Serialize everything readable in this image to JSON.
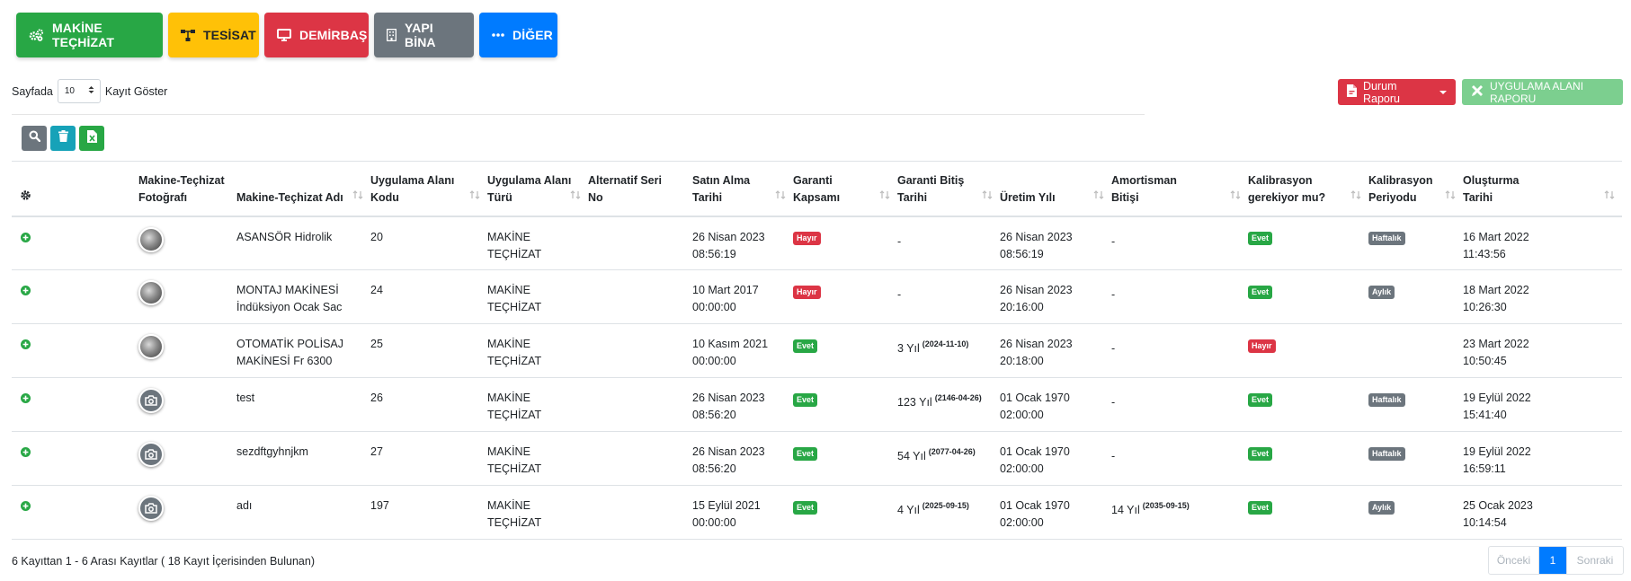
{
  "categories": [
    {
      "label": "MAKİNE TEÇHİZAT",
      "icon": "gears-icon",
      "color": "#28a745"
    },
    {
      "label": "TESİSAT",
      "icon": "network-icon",
      "color": "#ffc107"
    },
    {
      "label": "DEMİRBAŞ",
      "icon": "monitor-icon",
      "color": "#dc3545"
    },
    {
      "label": "YAPI BİNA",
      "icon": "building-icon",
      "color": "#6c757d"
    },
    {
      "label": "DİĞER",
      "icon": "ellipsis-icon",
      "color": "#007bff"
    }
  ],
  "length": {
    "prefix": "Sayfada",
    "value": "10",
    "suffix": "Kayıt Göster"
  },
  "reports": {
    "status_report": "Durum Raporu",
    "application_area_report": "UYGULAMA ALANI RAPORU"
  },
  "table": {
    "headers": {
      "photo": [
        "Makine-Teçhizat",
        "Fotoğrafı"
      ],
      "name": "Makine-Teçhizat Adı",
      "code": [
        "Uygulama Alanı",
        "Kodu"
      ],
      "type": [
        "Uygulama Alanı",
        "Türü"
      ],
      "serial": [
        "Alternatif Seri",
        "No"
      ],
      "purchase": [
        "Satın Alma",
        "Tarihi"
      ],
      "warranty": [
        "Garanti",
        "Kapsamı"
      ],
      "warranty_end": [
        "Garanti Bitiş",
        "Tarihi"
      ],
      "production": "Üretim Yılı",
      "amortization": [
        "Amortisman",
        "Bitişi"
      ],
      "calibration": [
        "Kalibrasyon",
        "gerekiyor mu?"
      ],
      "calibration_period": [
        "Kalibrasyon",
        "Periyodu"
      ],
      "created": [
        "Oluşturma",
        "Tarihi"
      ]
    },
    "rows": [
      {
        "photo": "image",
        "name": [
          "ASANSÖR Hidrolik",
          ""
        ],
        "code": "20",
        "type": "MAKİNE TEÇHİZAT",
        "serial": "",
        "purchase": [
          "26 Nisan 2023",
          "08:56:19"
        ],
        "warranty": "Hayır",
        "warranty_color": "#dc3545",
        "warranty_end": "-",
        "warranty_end_date": "",
        "production": [
          "26 Nisan 2023",
          "08:56:19"
        ],
        "amortization": "-",
        "amortization_date": "",
        "calibration": "Evet",
        "calibration_color": "#28a745",
        "period": "Haftalık",
        "created": [
          "16 Mart 2022",
          "11:43:56"
        ]
      },
      {
        "photo": "image",
        "name": [
          "MONTAJ MAKİNESİ",
          "İndüksiyon Ocak Sac"
        ],
        "code": "24",
        "type": "MAKİNE TEÇHİZAT",
        "serial": "",
        "purchase": [
          "10 Mart 2017",
          "00:00:00"
        ],
        "warranty": "Hayır",
        "warranty_color": "#dc3545",
        "warranty_end": "-",
        "warranty_end_date": "",
        "production": [
          "26 Nisan 2023",
          "20:16:00"
        ],
        "amortization": "-",
        "amortization_date": "",
        "calibration": "Evet",
        "calibration_color": "#28a745",
        "period": "Aylık",
        "created": [
          "18 Mart 2022",
          "10:26:30"
        ]
      },
      {
        "photo": "image",
        "name": [
          "OTOMATİK POLİSAJ",
          "MAKİNESİ Fr 6300"
        ],
        "code": "25",
        "type": "MAKİNE TEÇHİZAT",
        "serial": "",
        "purchase": [
          "10 Kasım 2021",
          "00:00:00"
        ],
        "warranty": "Evet",
        "warranty_color": "#28a745",
        "warranty_end": "3 Yıl",
        "warranty_end_date": "(2024-11-10)",
        "production": [
          "26 Nisan 2023",
          "20:18:00"
        ],
        "amortization": "-",
        "amortization_date": "",
        "calibration": "Hayır",
        "calibration_color": "#dc3545",
        "period": "",
        "created": [
          "23 Mart 2022",
          "10:50:45"
        ]
      },
      {
        "photo": "camera",
        "name": [
          "test",
          ""
        ],
        "code": "26",
        "type": "MAKİNE TEÇHİZAT",
        "serial": "",
        "purchase": [
          "26 Nisan 2023",
          "08:56:20"
        ],
        "warranty": "Evet",
        "warranty_color": "#28a745",
        "warranty_end": "123 Yıl",
        "warranty_end_date": "(2146-04-26)",
        "production": [
          "01 Ocak 1970",
          "02:00:00"
        ],
        "amortization": "-",
        "amortization_date": "",
        "calibration": "Evet",
        "calibration_color": "#28a745",
        "period": "Haftalık",
        "created": [
          "19 Eylül 2022",
          "15:41:40"
        ]
      },
      {
        "photo": "camera",
        "name": [
          "sezdftgyhnjkm",
          ""
        ],
        "code": "27",
        "type": "MAKİNE TEÇHİZAT",
        "serial": "",
        "purchase": [
          "26 Nisan 2023",
          "08:56:20"
        ],
        "warranty": "Evet",
        "warranty_color": "#28a745",
        "warranty_end": "54 Yıl",
        "warranty_end_date": "(2077-04-26)",
        "production": [
          "01 Ocak 1970",
          "02:00:00"
        ],
        "amortization": "-",
        "amortization_date": "",
        "calibration": "Evet",
        "calibration_color": "#28a745",
        "period": "Haftalık",
        "created": [
          "19 Eylül 2022",
          "16:59:11"
        ]
      },
      {
        "photo": "camera",
        "name": [
          "adı",
          ""
        ],
        "code": "197",
        "type": "MAKİNE TEÇHİZAT",
        "serial": "",
        "purchase": [
          "15 Eylül 2021",
          "00:00:00"
        ],
        "warranty": "Evet",
        "warranty_color": "#28a745",
        "warranty_end": "4 Yıl",
        "warranty_end_date": "(2025-09-15)",
        "production": [
          "01 Ocak 1970",
          "02:00:00"
        ],
        "amortization": "14 Yıl",
        "amortization_date": "(2035-09-15)",
        "calibration": "Evet",
        "calibration_color": "#28a745",
        "period": "Aylık",
        "created": [
          "25 Ocak 2023",
          "10:14:54"
        ]
      }
    ]
  },
  "footer": {
    "info": "6 Kayıttan 1 - 6 Arası Kayıtlar ( 18 Kayıt İçerisinden Bulunan)",
    "prev": "Önceki",
    "current": "1",
    "next": "Sonraki"
  }
}
